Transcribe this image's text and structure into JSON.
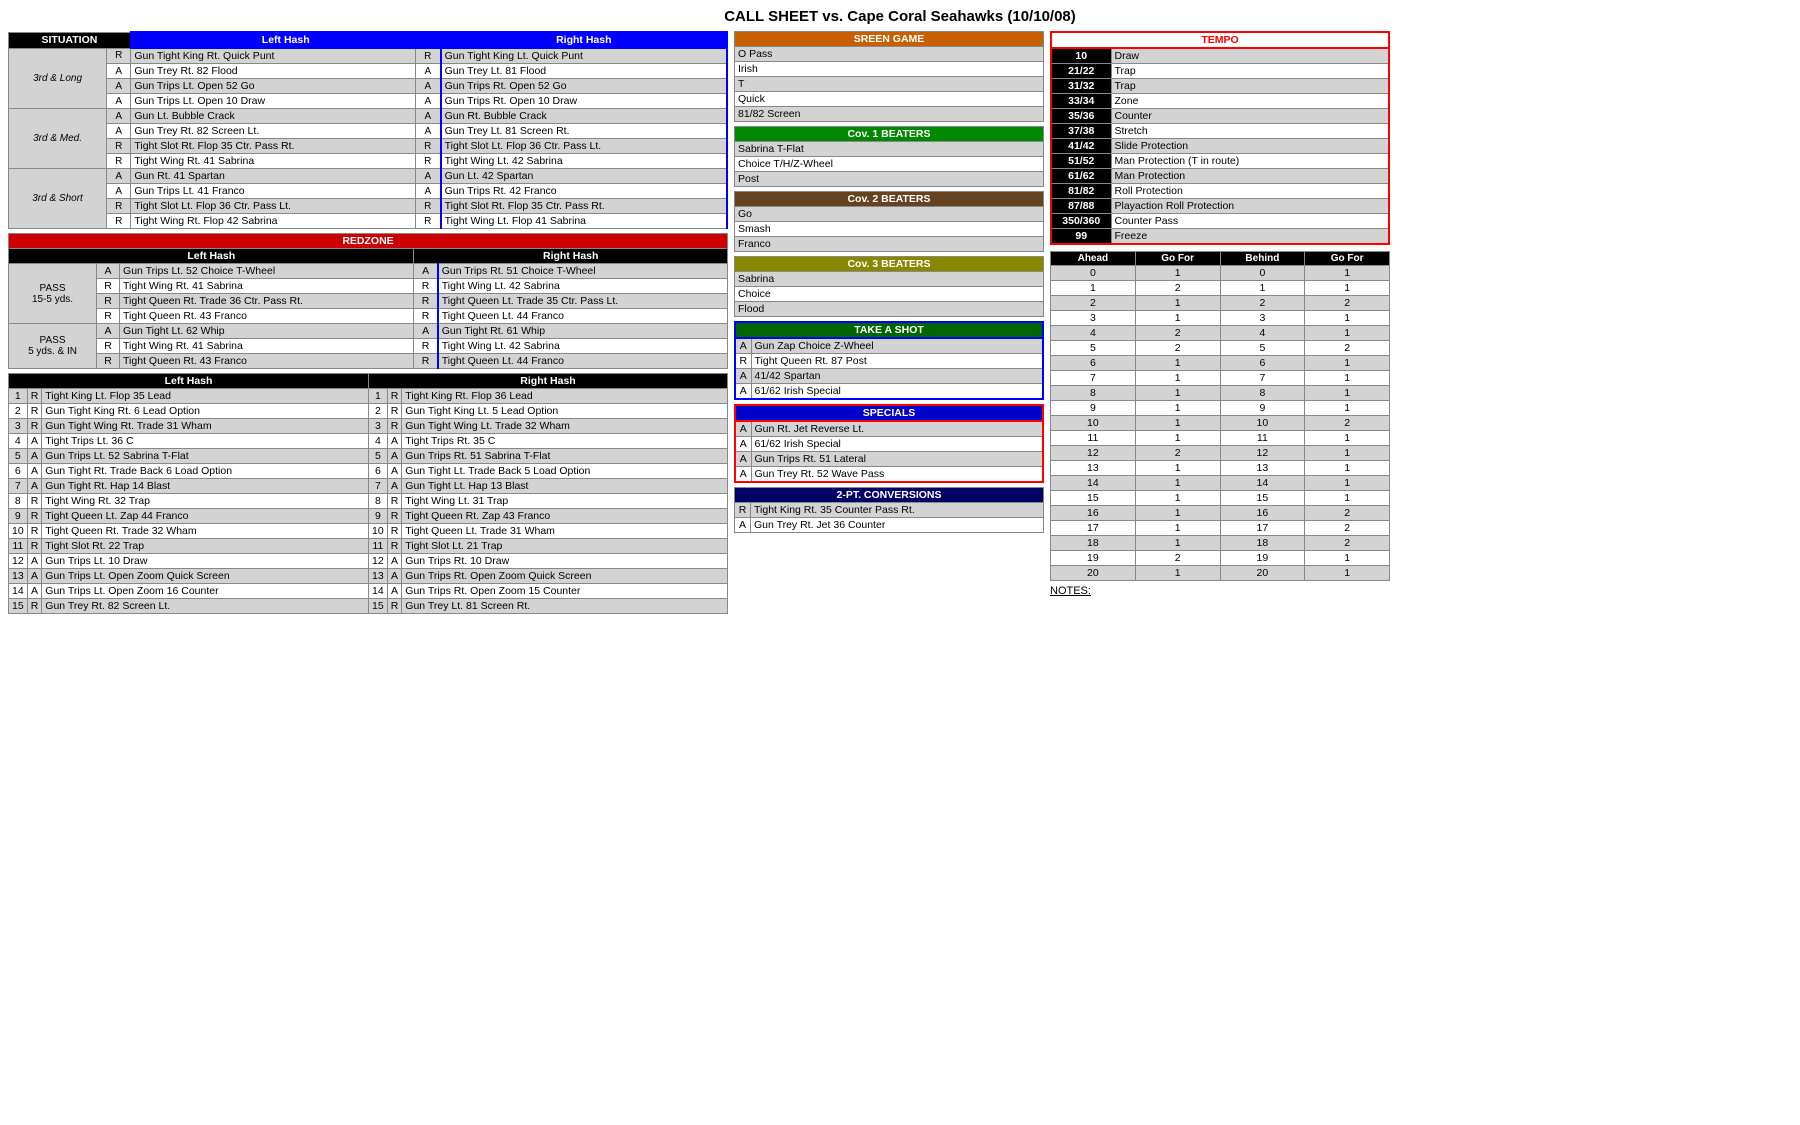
{
  "title": "CALL SHEET vs. Cape Coral Seahawks (10/10/08)",
  "situation": {
    "header": "SITUATION",
    "lh": "Left Hash",
    "rh": "Right Hash",
    "rows": [
      {
        "sit": "3rd & Long",
        "rows": [
          {
            "type": "R",
            "lh": "Gun Tight King Rt. Quick Punt",
            "rh": "Gun Tight King Lt. Quick Punt"
          },
          {
            "type": "A",
            "lh": "Gun Trey Rt. 82 Flood",
            "rh": "Gun Trey Lt. 81 Flood"
          },
          {
            "type": "A",
            "lh": "Gun Trips Lt. Open 52 Go",
            "rh": "Gun Trips Rt. Open 52 Go"
          },
          {
            "type": "A",
            "lh": "Gun Trips Lt. Open 10 Draw",
            "rh": "Gun Trips Rt. Open 10 Draw"
          }
        ]
      },
      {
        "sit": "3rd & Med.",
        "rows": [
          {
            "type": "A",
            "lh": "Gun Lt. Bubble Crack",
            "rh": "Gun Rt. Bubble Crack"
          },
          {
            "type": "A",
            "lh": "Gun Trey Rt. 82 Screen Lt.",
            "rh": "Gun Trey Lt. 81 Screen Rt."
          },
          {
            "type": "R",
            "lh": "Tight Slot Rt. Flop 35 Ctr. Pass Rt.",
            "rh": "Tight Slot Lt. Flop 36 Ctr. Pass Lt."
          },
          {
            "type": "R",
            "lh": "Tight Wing Rt. 41 Sabrina",
            "rh": "Tight Wing Lt. 42 Sabrina"
          }
        ]
      },
      {
        "sit": "3rd & Short",
        "rows": [
          {
            "type": "A",
            "lh": "Gun Rt. 41 Spartan",
            "rh": "Gun Lt. 42 Spartan"
          },
          {
            "type": "A",
            "lh": "Gun Trips Lt. 41 Franco",
            "rh": "Gun Trips Rt. 42 Franco"
          },
          {
            "type": "R",
            "lh": "Tight Slot Lt. Flop 36 Ctr. Pass Lt.",
            "rh": "Tight Slot Rt. Flop 35 Ctr. Pass Rt."
          },
          {
            "type": "R",
            "lh": "Tight Wing Rt. Flop 42 Sabrina",
            "rh": "Tight Wing Lt. Flop 41 Sabrina"
          }
        ]
      }
    ]
  },
  "redzone": {
    "header": "REDZONE",
    "lh_header": "Left Hash",
    "rh_header": "Right Hash",
    "pass1_label": "PASS\n15-5 yds.",
    "pass2_label": "PASS\n5 yds. & IN",
    "pass1_rows": [
      {
        "type": "A",
        "lh": "Gun Trips Lt. 52 Choice T-Wheel",
        "rh": "Gun Trips Rt. 51 Choice T-Wheel"
      },
      {
        "type": "R",
        "lh": "Tight Wing Rt. 41 Sabrina",
        "rh": "Tight Wing Lt. 42 Sabrina"
      },
      {
        "type": "R",
        "lh": "Tight Queen Rt. Trade 36 Ctr. Pass Rt.",
        "rh": "Tight Queen Lt. Trade 35 Ctr. Pass Lt."
      },
      {
        "type": "R",
        "lh": "Tight Queen Rt. 43 Franco",
        "rh": "Tight Queen Lt. 44 Franco"
      }
    ],
    "pass2_rows": [
      {
        "type": "A",
        "lh": "Gun Tight Lt. 62 Whip",
        "rh": "Gun Tight Rt. 61 Whip"
      },
      {
        "type": "R",
        "lh": "Tight Wing Rt. 41 Sabrina",
        "rh": "Tight Wing Lt. 42 Sabrina"
      },
      {
        "type": "R",
        "lh": "Tight Queen Rt. 43 Franco",
        "rh": "Tight Queen Lt. 44 Franco"
      }
    ]
  },
  "lower_plays": {
    "lh_header": "Left Hash",
    "rh_header": "Right Hash",
    "rows": [
      {
        "num": 1,
        "type": "R",
        "lh": "Tight King Lt. Flop 35 Lead",
        "rh": "Tight King Rt. Flop 36 Lead"
      },
      {
        "num": 2,
        "type": "R",
        "lh": "Gun Tight King Rt. 6 Lead Option",
        "rh": "Gun Tight King Lt. 5 Lead Option"
      },
      {
        "num": 3,
        "type": "R",
        "lh": "Gun Tight Wing Rt. Trade 31 Wham",
        "rh": "Gun Tight Wing Lt. Trade 32 Wham"
      },
      {
        "num": 4,
        "type": "A",
        "lh": "Tight Trips Lt. 36 C",
        "rh": "Tight Trips Rt. 35 C"
      },
      {
        "num": 5,
        "type": "A",
        "lh": "Gun Trips Lt. 52 Sabrina T-Flat",
        "rh": "Gun Trips Rt. 51 Sabrina T-Flat"
      },
      {
        "num": 6,
        "type": "A",
        "lh": "Gun Tight Rt. Trade Back 6 Load Option",
        "rh": "Gun Tight Lt. Trade Back 5 Load Option"
      },
      {
        "num": 7,
        "type": "A",
        "lh": "Gun Tight Rt. Hap 14 Blast",
        "rh": "Gun Tight Lt. Hap 13 Blast"
      },
      {
        "num": 8,
        "type": "R",
        "lh": "Tight Wing Rt. 32 Trap",
        "rh": "Tight Wing Lt. 31 Trap"
      },
      {
        "num": 9,
        "type": "R",
        "lh": "Tight Queen Lt. Zap 44 Franco",
        "rh": "Tight Queen Rt. Zap 43 Franco"
      },
      {
        "num": 10,
        "type": "R",
        "lh": "Tight Queen Rt. Trade 32 Wham",
        "rh": "Tight Queen Lt. Trade 31 Wham"
      },
      {
        "num": 11,
        "type": "R",
        "lh": "Tight Slot Rt. 22 Trap",
        "rh": "Tight Slot Lt. 21 Trap"
      },
      {
        "num": 12,
        "type": "A",
        "lh": "Gun Trips Lt. 10 Draw",
        "rh": "Gun Trips Rt. 10 Draw"
      },
      {
        "num": 13,
        "type": "A",
        "lh": "Gun Trips Lt. Open Zoom Quick Screen",
        "rh": "Gun Trips Rt. Open Zoom Quick Screen"
      },
      {
        "num": 14,
        "type": "A",
        "lh": "Gun Trips Lt. Open Zoom 16 Counter",
        "rh": "Gun Trips Rt. Open Zoom 15 Counter"
      },
      {
        "num": 15,
        "type": "R",
        "lh": "Gun Trey Rt. 82 Screen Lt.",
        "rh": "Gun Trey Lt. 81 Screen Rt."
      }
    ]
  },
  "screen_game": {
    "header": "SREEN GAME",
    "rows": [
      "O Pass",
      "Irish",
      "T",
      "Quick",
      "81/82 Screen"
    ]
  },
  "cov1": {
    "header": "Cov. 1 BEATERS",
    "rows": [
      "Sabrina T-Flat",
      "Choice T/H/Z-Wheel",
      "Post"
    ]
  },
  "cov2": {
    "header": "Cov. 2 BEATERS",
    "rows": [
      "Go",
      "Smash",
      "Franco"
    ]
  },
  "cov3": {
    "header": "Cov. 3 BEATERS",
    "rows": [
      "Sabrina",
      "Choice",
      "Flood"
    ]
  },
  "take_a_shot": {
    "header": "TAKE A SHOT",
    "rows": [
      {
        "type": "A",
        "play": "Gun Zap Choice Z-Wheel"
      },
      {
        "type": "R",
        "play": "Tight Queen Rt. 87 Post"
      },
      {
        "type": "A",
        "play": "41/42 Spartan"
      },
      {
        "type": "A",
        "play": "61/62 Irish Special"
      }
    ]
  },
  "specials": {
    "header": "SPECIALS",
    "rows": [
      {
        "type": "A",
        "play": "Gun Rt. Jet Reverse Lt."
      },
      {
        "type": "A",
        "play": "61/62 Irish Special"
      },
      {
        "type": "A",
        "play": "Gun Trips Rt. 51 Lateral"
      },
      {
        "type": "A",
        "play": "Gun Trey Rt. 52 Wave Pass"
      }
    ]
  },
  "conversions": {
    "header": "2-PT. CONVERSIONS",
    "rows": [
      {
        "type": "R",
        "play": "Tight King Rt. 35 Counter Pass Rt."
      },
      {
        "type": "A",
        "play": "Gun Trey Rt. Jet 36 Counter"
      }
    ]
  },
  "tempo": {
    "header": "TEMPO",
    "rows": [
      {
        "num": "10",
        "desc": "Draw"
      },
      {
        "num": "21/22",
        "desc": "Trap"
      },
      {
        "num": "31/32",
        "desc": "Trap"
      },
      {
        "num": "33/34",
        "desc": "Zone"
      },
      {
        "num": "35/36",
        "desc": "Counter"
      },
      {
        "num": "37/38",
        "desc": "Stretch"
      },
      {
        "num": "41/42",
        "desc": "Slide Protection"
      },
      {
        "num": "51/52",
        "desc": "Man Protection (T in route)"
      },
      {
        "num": "61/62",
        "desc": "Man Protection"
      },
      {
        "num": "81/82",
        "desc": "Roll Protection"
      },
      {
        "num": "87/88",
        "desc": "Playaction Roll Protection"
      },
      {
        "num": "350/360",
        "desc": "Counter Pass"
      },
      {
        "num": "99",
        "desc": "Freeze"
      }
    ]
  },
  "go_for_table": {
    "headers": [
      "Ahead",
      "Go For",
      "Behind",
      "Go For"
    ],
    "rows": [
      {
        "ahead": "0",
        "gofor1": "1",
        "behind": "0",
        "gofor2": "1"
      },
      {
        "ahead": "1",
        "gofor1": "2",
        "behind": "1",
        "gofor2": "1"
      },
      {
        "ahead": "2",
        "gofor1": "1",
        "behind": "2",
        "gofor2": "2"
      },
      {
        "ahead": "3",
        "gofor1": "1",
        "behind": "3",
        "gofor2": "1"
      },
      {
        "ahead": "4",
        "gofor1": "2",
        "behind": "4",
        "gofor2": "1"
      },
      {
        "ahead": "5",
        "gofor1": "2",
        "behind": "5",
        "gofor2": "2"
      },
      {
        "ahead": "6",
        "gofor1": "1",
        "behind": "6",
        "gofor2": "1"
      },
      {
        "ahead": "7",
        "gofor1": "1",
        "behind": "7",
        "gofor2": "1"
      },
      {
        "ahead": "8",
        "gofor1": "1",
        "behind": "8",
        "gofor2": "1"
      },
      {
        "ahead": "9",
        "gofor1": "1",
        "behind": "9",
        "gofor2": "1"
      },
      {
        "ahead": "10",
        "gofor1": "1",
        "behind": "10",
        "gofor2": "2"
      },
      {
        "ahead": "11",
        "gofor1": "1",
        "behind": "11",
        "gofor2": "1"
      },
      {
        "ahead": "12",
        "gofor1": "2",
        "behind": "12",
        "gofor2": "1"
      },
      {
        "ahead": "13",
        "gofor1": "1",
        "behind": "13",
        "gofor2": "1"
      },
      {
        "ahead": "14",
        "gofor1": "1",
        "behind": "14",
        "gofor2": "1"
      },
      {
        "ahead": "15",
        "gofor1": "1",
        "behind": "15",
        "gofor2": "1"
      },
      {
        "ahead": "16",
        "gofor1": "1",
        "behind": "16",
        "gofor2": "2"
      },
      {
        "ahead": "17",
        "gofor1": "1",
        "behind": "17",
        "gofor2": "2"
      },
      {
        "ahead": "18",
        "gofor1": "1",
        "behind": "18",
        "gofor2": "2"
      },
      {
        "ahead": "19",
        "gofor1": "2",
        "behind": "19",
        "gofor2": "1"
      },
      {
        "ahead": "20",
        "gofor1": "1",
        "behind": "20",
        "gofor2": "1"
      }
    ]
  },
  "notes_label": "NOTES:"
}
